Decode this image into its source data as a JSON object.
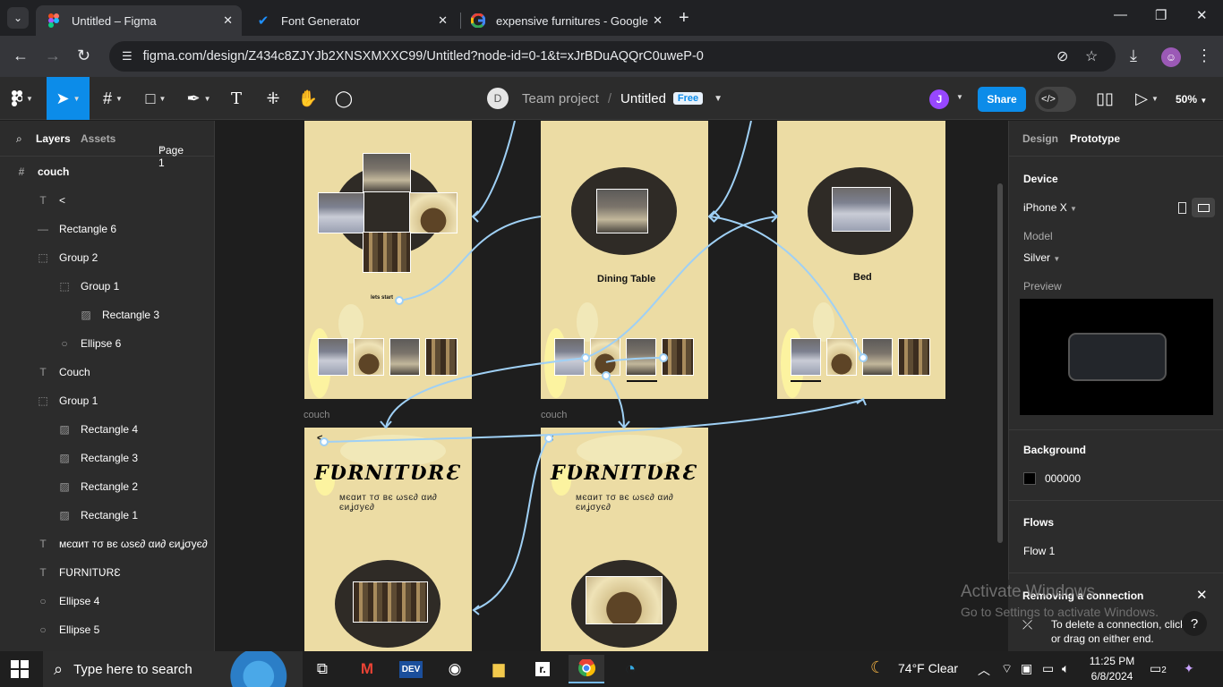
{
  "browser": {
    "tabs": [
      {
        "title": "Untitled – Figma",
        "active": true
      },
      {
        "title": "Font Generator",
        "active": false
      },
      {
        "title": "expensive furnitures - Google S",
        "active": false
      }
    ],
    "url": "figma.com/design/Z434c8ZJYJb2XNSXMXXC99/Untitled?node-id=0-1&t=xJrBDuAQQrC0uweP-0"
  },
  "toolbar": {
    "project_avatar": "D",
    "team": "Team project",
    "separator": "/",
    "file_name": "Untitled",
    "plan_badge": "Free",
    "user_avatar": "J",
    "share_label": "Share",
    "zoom": "50%"
  },
  "left_panel": {
    "tab_layers": "Layers",
    "tab_assets": "Assets",
    "page": "Page 1",
    "layers": [
      {
        "name": "couch",
        "icon": "#",
        "indent": 0
      },
      {
        "name": "<",
        "icon": "T",
        "indent": 1
      },
      {
        "name": "Rectangle 6",
        "icon": "—",
        "indent": 1
      },
      {
        "name": "Group 2",
        "icon": "⬚",
        "indent": 1
      },
      {
        "name": "Group 1",
        "icon": "⬚",
        "indent": 2
      },
      {
        "name": "Rectangle 3",
        "icon": "▨",
        "indent": 3
      },
      {
        "name": "Ellipse 6",
        "icon": "○",
        "indent": 2
      },
      {
        "name": "Couch",
        "icon": "T",
        "indent": 1
      },
      {
        "name": "Group 1",
        "icon": "⬚",
        "indent": 1
      },
      {
        "name": "Rectangle 4",
        "icon": "▨",
        "indent": 2
      },
      {
        "name": "Rectangle 3",
        "icon": "▨",
        "indent": 2
      },
      {
        "name": "Rectangle 2",
        "icon": "▨",
        "indent": 2
      },
      {
        "name": "Rectangle 1",
        "icon": "▨",
        "indent": 2
      },
      {
        "name": "мєαит тσ вє ωѕє∂ αи∂ єиʝσує∂",
        "icon": "T",
        "indent": 1
      },
      {
        "name": "FƲRNITƲRƐ",
        "icon": "T",
        "indent": 1
      },
      {
        "name": "Ellipse 4",
        "icon": "○",
        "indent": 1
      },
      {
        "name": "Ellipse 5",
        "icon": "○",
        "indent": 1
      }
    ]
  },
  "canvas": {
    "frame_label_1": "couch",
    "frame_label_2": "couch",
    "start_text": "lets start",
    "dining_title": "Dining Table",
    "bed_title": "Bed",
    "furniture_title": "FƲRNITƲRƐ",
    "tagline": "мєαит тσ вє ωѕє∂ αи∂ єиʝσує∂",
    "back_glyph": "<"
  },
  "right_panel": {
    "tab_design": "Design",
    "tab_prototype": "Prototype",
    "device_heading": "Device",
    "device_value": "iPhone X",
    "model_label": "Model",
    "model_value": "Silver",
    "preview_label": "Preview",
    "background_heading": "Background",
    "background_value": "000000",
    "flows_heading": "Flows",
    "flow_name": "Flow 1",
    "toast_title": "Removing a connection",
    "toast_body": "To delete a connection, click or drag on either end."
  },
  "watermark": {
    "line1": "Activate Windows",
    "line2": "Go to Settings to activate Windows."
  },
  "taskbar": {
    "search_placeholder": "Type here to search",
    "weather": "74°F  Clear",
    "time": "11:25 PM",
    "date": "6/8/2024",
    "notifications": "2"
  },
  "colors": {
    "accent": "#0c8ce9",
    "frame_bg": "#ecdca4",
    "connector": "#9fd0f5"
  }
}
